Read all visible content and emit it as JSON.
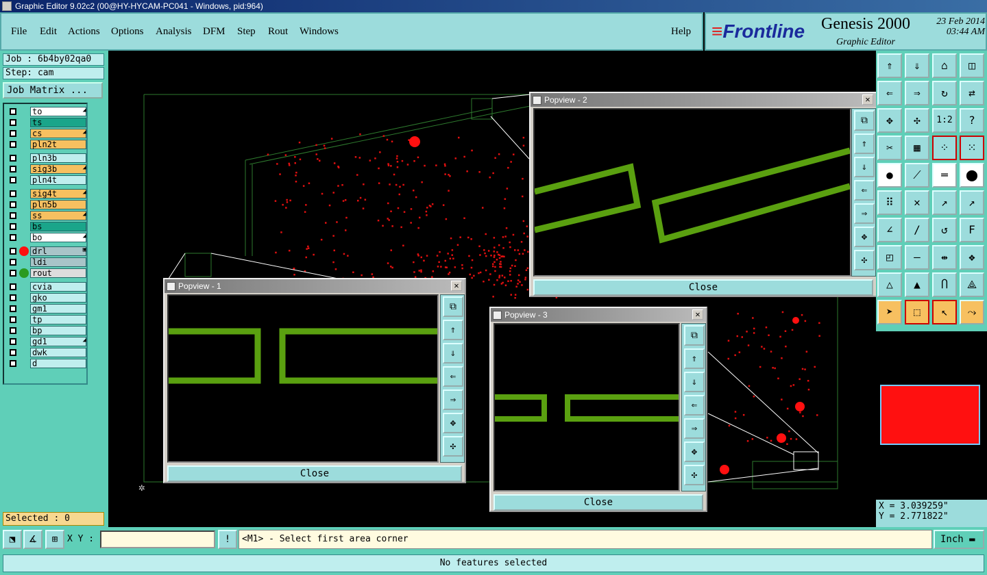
{
  "window": {
    "title": "Graphic Editor 9.02c2 (00@HY-HYCAM-PC041 - Windows, pid:964)"
  },
  "menu": {
    "items": [
      "File",
      "Edit",
      "Actions",
      "Options",
      "Analysis",
      "DFM",
      "Step",
      "Rout",
      "Windows"
    ],
    "help": "Help"
  },
  "brand": {
    "logo_pre": "Front",
    "logo_post": "line",
    "product": "Genesis 2000",
    "subtitle": "Graphic Editor",
    "date": "23 Feb 2014",
    "time": "03:44 AM"
  },
  "left": {
    "job": "Job : 6b4by02qa0",
    "step": "Step: cam",
    "job_matrix": "Job Matrix ...",
    "selected": "Selected : 0"
  },
  "layers": [
    {
      "name": "to",
      "color": "#ffffff",
      "mark": "◢"
    },
    {
      "name": "ts",
      "color": "#1aa58a",
      "mark": ""
    },
    {
      "name": "cs",
      "color": "#f7c060",
      "mark": "◢"
    },
    {
      "name": "pln2t",
      "color": "#f7c060",
      "mark": ""
    },
    {
      "name": "pln3b",
      "color": "#bfeeee",
      "mark": ""
    },
    {
      "name": "sig3b",
      "color": "#f7c060",
      "mark": "◢"
    },
    {
      "name": "pln4t",
      "color": "#bfeeee",
      "mark": ""
    },
    {
      "name": "sig4t",
      "color": "#f7c060",
      "mark": "◢"
    },
    {
      "name": "pln5b",
      "color": "#f7c060",
      "mark": ""
    },
    {
      "name": "ss",
      "color": "#f7c060",
      "mark": "◢"
    },
    {
      "name": "bs",
      "color": "#1aa58a",
      "mark": ""
    },
    {
      "name": "bo",
      "color": "#ffffff",
      "mark": "◢"
    },
    {
      "name": "drl",
      "color": "#a8c4c8",
      "mark": "▣"
    },
    {
      "name": "ldi",
      "color": "#a8c4c8",
      "mark": ""
    },
    {
      "name": "rout",
      "color": "#dddddd",
      "mark": ""
    },
    {
      "name": "cvia",
      "color": "#bfeeee",
      "mark": ""
    },
    {
      "name": "gko",
      "color": "#bfeeee",
      "mark": ""
    },
    {
      "name": "gm1",
      "color": "#bfeeee",
      "mark": ""
    },
    {
      "name": "tp",
      "color": "#bfeeee",
      "mark": ""
    },
    {
      "name": "bp",
      "color": "#bfeeee",
      "mark": ""
    },
    {
      "name": "gd1",
      "color": "#bfeeee",
      "mark": "◢"
    },
    {
      "name": "dwk",
      "color": "#bfeeee",
      "mark": ""
    },
    {
      "name": "d",
      "color": "#bfeeee",
      "mark": ""
    }
  ],
  "popups": [
    {
      "title": "Popview - 1",
      "close": "Close"
    },
    {
      "title": "Popview - 2",
      "close": "Close"
    },
    {
      "title": "Popview - 3",
      "close": "Close"
    }
  ],
  "coords": {
    "x": "X = 3.039259\"",
    "y": "Y = 2.771822\""
  },
  "bottom": {
    "xy_label": "X Y :",
    "xy_value": "",
    "prompt": "<M1> - Select first area corner",
    "unit": "Inch"
  },
  "status": "No features selected",
  "colors": {
    "feature": "#ff0000",
    "trace": "#5aa010",
    "outline": "#2e7a2e"
  }
}
